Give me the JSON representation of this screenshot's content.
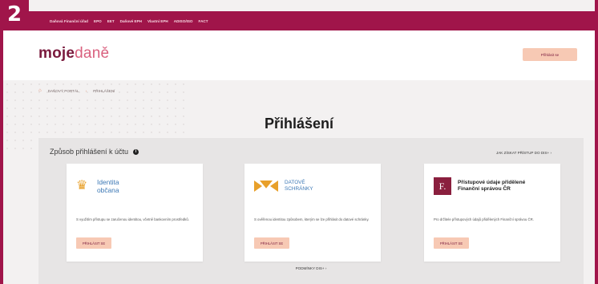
{
  "step_number": "2",
  "topbar": {
    "links": [
      "Daňová Finanční úřad",
      "EPO",
      "EET",
      "Daňové EPH",
      "Vlastní EPH",
      "ADISO/ISO",
      "FACT"
    ]
  },
  "header": {
    "logo_part1": "moje",
    "logo_part2": "daně",
    "login_button": "Přihlásit se"
  },
  "breadcrumb": {
    "items": [
      "DAŇOVÝ PORTÁL",
      "PŘIHLÁŠENÍ"
    ]
  },
  "page_title": "Přihlášení",
  "panel": {
    "title": "Způsob přihlášení k účtu",
    "howto_link": "JAK ZÍSKAT PŘÍSTUP DO DIS+ ›",
    "conditions_link": "PODMÍNKY DIS+ ›"
  },
  "cards": [
    {
      "title_line1": "Identita",
      "title_line2": "občana",
      "description": "S využitím přístupu se zaručenou identitou, včetně bankovním prostředků.",
      "button": "PŘIHLÁSIT SE"
    },
    {
      "title_line1": "DATOVÉ",
      "title_line2": "SCHRÁNKY",
      "description": "S ověřenou identitou způsobem, kterým se lze přihlásit do datové schránky.",
      "button": "PŘIHLÁSIT SE"
    },
    {
      "logo_letter": "F.",
      "title": "Přístupové údaje přidělené Finanční správou ČR",
      "description": "Pro držitele přístupových údajů přidělených Finanční správou ČR.",
      "button": "PŘIHLÁSIT SE"
    }
  ],
  "colors": {
    "brand": "#a0154a",
    "accent_button": "#f7c9b4",
    "link_blue": "#3c78b5",
    "gold": "#e8a02a"
  },
  "icons": [
    "home-icon",
    "info-icon",
    "lion-icon",
    "datove-schranky-icon",
    "f-logo-icon"
  ]
}
